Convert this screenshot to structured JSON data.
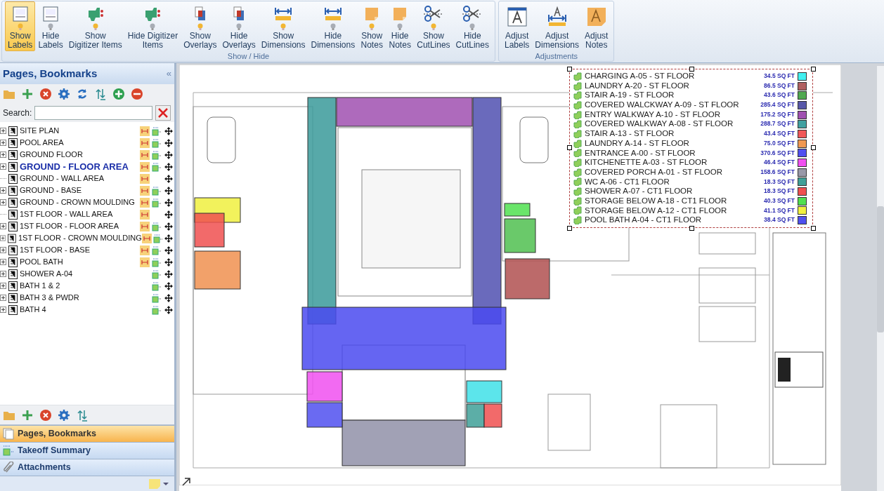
{
  "ribbon": {
    "groups": [
      {
        "title": "Show / Hide",
        "buttons": [
          {
            "label": "Show\nLabels",
            "kind": "count",
            "lit": true,
            "selected": true
          },
          {
            "label": "Hide\nLabels",
            "kind": "count",
            "lit": false,
            "selected": false
          },
          {
            "label": "Show\nDigitizer Items",
            "kind": "digitizer",
            "lit": true,
            "selected": false
          },
          {
            "label": "Hide Digitizer\nItems",
            "kind": "digitizer",
            "lit": false,
            "selected": false
          },
          {
            "label": "Show\nOverlays",
            "kind": "overlay",
            "lit": true,
            "selected": false
          },
          {
            "label": "Hide\nOverlays",
            "kind": "overlay",
            "lit": false,
            "selected": false
          },
          {
            "label": "Show\nDimensions",
            "kind": "dimension",
            "lit": true,
            "selected": false
          },
          {
            "label": "Hide\nDimensions",
            "kind": "dimension",
            "lit": false,
            "selected": false
          },
          {
            "label": "Show\nNotes",
            "kind": "note",
            "lit": true,
            "selected": false
          },
          {
            "label": "Hide\nNotes",
            "kind": "note",
            "lit": false,
            "selected": false
          },
          {
            "label": "Show\nCutLines",
            "kind": "cutline",
            "lit": true,
            "selected": false
          },
          {
            "label": "Hide\nCutLines",
            "kind": "cutline",
            "lit": false,
            "selected": false
          }
        ]
      },
      {
        "title": "Adjustments",
        "buttons": [
          {
            "label": "Adjust\nLabels",
            "kind": "adjust-label",
            "selected": false
          },
          {
            "label": "Adjust\nDimensions",
            "kind": "adjust-dimension",
            "selected": false
          },
          {
            "label": "Adjust\nNotes",
            "kind": "adjust-note",
            "selected": false
          }
        ]
      }
    ]
  },
  "sidebar": {
    "title": "Pages, Bookmarks",
    "collapse": "«",
    "search_label": "Search:",
    "pages": [
      {
        "label": "SITE PLAN",
        "expandable": true,
        "dimensions": true,
        "digitizer": true,
        "selected": false
      },
      {
        "label": "POOL AREA",
        "expandable": true,
        "dimensions": true,
        "digitizer": true,
        "selected": false
      },
      {
        "label": "GROUND FLOOR",
        "expandable": true,
        "dimensions": true,
        "digitizer": true,
        "selected": false
      },
      {
        "label": "GROUND - FLOOR AREA",
        "expandable": true,
        "dimensions": true,
        "digitizer": true,
        "selected": true
      },
      {
        "label": "GROUND - WALL AREA",
        "expandable": false,
        "dimensions": true,
        "digitizer": false,
        "selected": false
      },
      {
        "label": "GROUND - BASE",
        "expandable": true,
        "dimensions": true,
        "digitizer": true,
        "selected": false
      },
      {
        "label": "GROUND - CROWN MOULDING",
        "expandable": true,
        "dimensions": true,
        "digitizer": true,
        "selected": false
      },
      {
        "label": "1ST FLOOR - WALL AREA",
        "expandable": false,
        "dimensions": true,
        "digitizer": false,
        "selected": false
      },
      {
        "label": "1ST FLOOR - FLOOR AREA",
        "expandable": true,
        "dimensions": true,
        "digitizer": true,
        "selected": false
      },
      {
        "label": "1ST FLOOR - CROWN MOULDING",
        "expandable": true,
        "dimensions": true,
        "digitizer": true,
        "selected": false
      },
      {
        "label": "1ST FLOOR - BASE",
        "expandable": true,
        "dimensions": true,
        "digitizer": true,
        "selected": false
      },
      {
        "label": "POOL BATH",
        "expandable": true,
        "dimensions": true,
        "digitizer": true,
        "selected": false
      },
      {
        "label": "SHOWER A-04",
        "expandable": true,
        "dimensions": false,
        "digitizer": true,
        "selected": false
      },
      {
        "label": "BATH 1 & 2",
        "expandable": true,
        "dimensions": false,
        "digitizer": true,
        "selected": false
      },
      {
        "label": "BATH 3 & PWDR",
        "expandable": true,
        "dimensions": false,
        "digitizer": true,
        "selected": false
      },
      {
        "label": "BATH 4",
        "expandable": true,
        "dimensions": false,
        "digitizer": true,
        "selected": false
      }
    ],
    "panels": [
      {
        "label": "Pages, Bookmarks",
        "kind": "pages",
        "selected": true
      },
      {
        "label": "Takeoff Summary",
        "kind": "takeoff",
        "selected": false
      },
      {
        "label": "Attachments",
        "kind": "clip",
        "selected": false
      }
    ]
  },
  "legend": [
    {
      "label": "CHARGING A-05 - ST FLOOR",
      "area": "34.5 SQ FT",
      "color": "#40f0f0"
    },
    {
      "label": "LAUNDRY A-20 - ST FLOOR",
      "area": "86.5 SQ FT",
      "color": "#b06060"
    },
    {
      "label": "STAIR A-19 - ST FLOOR",
      "area": "43.6 SQ FT",
      "color": "#50a850"
    },
    {
      "label": "COVERED WALCKWAY A-09 - ST FLOOR",
      "area": "285.4 SQ FT",
      "color": "#5858a8"
    },
    {
      "label": "ENTRY WALKWAY A-10 - ST FLOOR",
      "area": "175.2 SQ FT",
      "color": "#a050b0"
    },
    {
      "label": "COVERED WALKWAY A-08 - ST FLOOR",
      "area": "288.7 SQ FT",
      "color": "#40a0a0"
    },
    {
      "label": "STAIR A-13  - ST FLOOR",
      "area": "43.4 SQ FT",
      "color": "#f05858"
    },
    {
      "label": "LAUNDRY A-14 - ST FLOOR",
      "area": "75.0 SQ FT",
      "color": "#f09850"
    },
    {
      "label": "ENTRANCE A-00 - ST FLOOR",
      "area": "370.6 SQ FT",
      "color": "#5050f0"
    },
    {
      "label": "KITCHENETTE A-03  - ST FLOOR",
      "area": "46.4 SQ FT",
      "color": "#f050f0"
    },
    {
      "label": "COVERED PORCH A-01  - ST FLOOR",
      "area": "158.6 SQ FT",
      "color": "#9898a8"
    },
    {
      "label": "WC A-06 - CT1 FLOOR",
      "area": "18.3 SQ FT",
      "color": "#40a098"
    },
    {
      "label": "SHOWER A-07 - CT1 FLOOR",
      "area": "18.3 SQ FT",
      "color": "#f05050"
    },
    {
      "label": "STORAGE BELOW A-18 - CT1 FLOOR",
      "area": "40.3 SQ FT",
      "color": "#50e050"
    },
    {
      "label": "STORAGE BELOW A-12 - CT1 FLOOR",
      "area": "41.1 SQ FT",
      "color": "#f0f040"
    },
    {
      "label": "POOL BATH A-04 - CT1 FLOOR",
      "area": "38.4 SQ FT",
      "color": "#5050f0"
    }
  ]
}
